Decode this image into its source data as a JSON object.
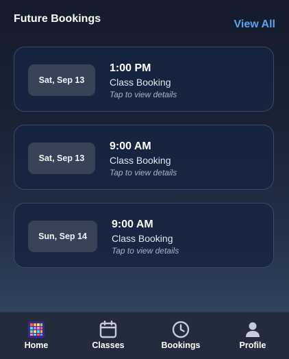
{
  "header": {
    "title": "Future Bookings",
    "view_all": "View All"
  },
  "bookings": [
    {
      "date": "Sat, Sep 13",
      "time": "1:00 PM",
      "type": "Class Booking",
      "hint": "Tap to view details"
    },
    {
      "date": "Sat, Sep 13",
      "time": "9:00 AM",
      "type": "Class Booking",
      "hint": "Tap to view details"
    },
    {
      "date": "Sun, Sep 14",
      "time": "9:00 AM",
      "type": "Class Booking",
      "hint": "Tap to view details"
    }
  ],
  "tabs": [
    {
      "label": "Home",
      "icon": "home-grid-icon"
    },
    {
      "label": "Classes",
      "icon": "calendar-icon"
    },
    {
      "label": "Bookings",
      "icon": "clock-icon"
    },
    {
      "label": "Profile",
      "icon": "person-icon"
    }
  ],
  "colors": {
    "accent": "#5aa4f0",
    "card_border": "#3a4a68",
    "date_pill": "#384357",
    "tabbar": "#222c3c"
  }
}
